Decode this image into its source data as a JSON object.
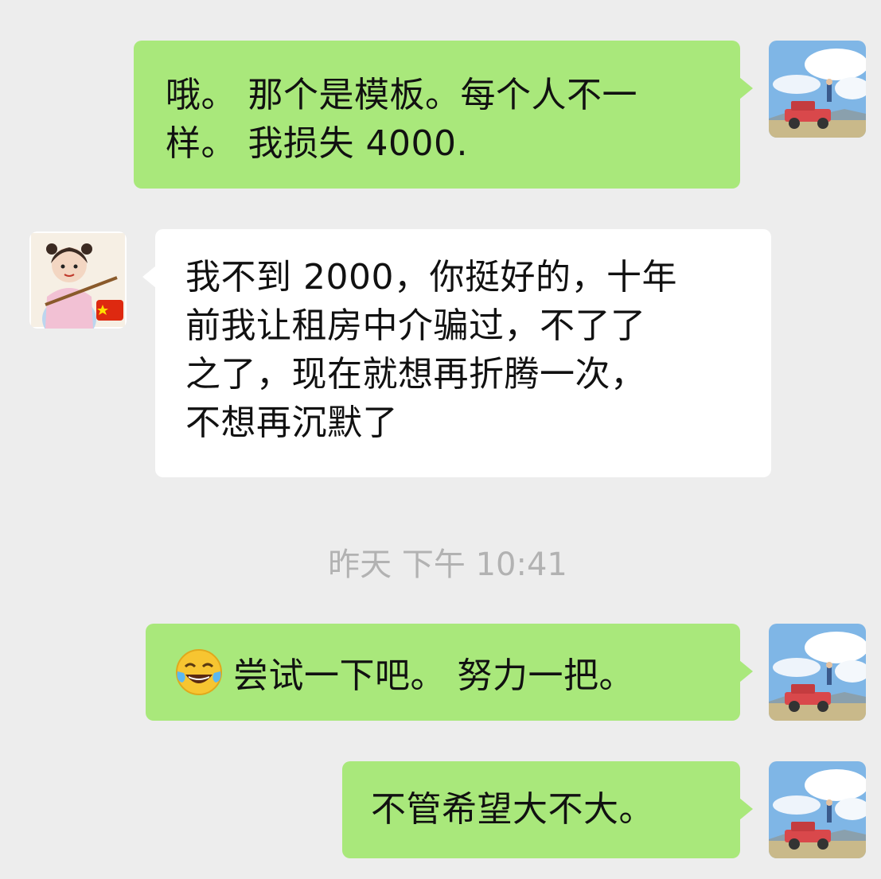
{
  "messages": [
    {
      "sender": "me",
      "lines": [
        "哦。 那个是模板。每个人不一",
        "样。 我损失 4000."
      ]
    },
    {
      "sender": "them",
      "lines": [
        "我不到 2000，你挺好的，十年",
        "前我让租房中介骗过，不了了",
        "之了，现在就想再折腾一次，",
        "不想再沉默了"
      ]
    },
    {
      "sender": "me",
      "emoji": "tears-of-joy-emoji",
      "text": "尝试一下吧。 努力一把。"
    },
    {
      "sender": "me",
      "text": "不管希望大不大。"
    }
  ],
  "timestamp": "昨天 下午 10:41",
  "avatars": {
    "me": "red-jeep-landscape-avatar",
    "them": "girl-with-flute-avatar"
  },
  "colors": {
    "background": "#ededed",
    "my_bubble": "#a9e87b",
    "their_bubble": "#ffffff",
    "timestamp_text": "#b2b2b2"
  }
}
